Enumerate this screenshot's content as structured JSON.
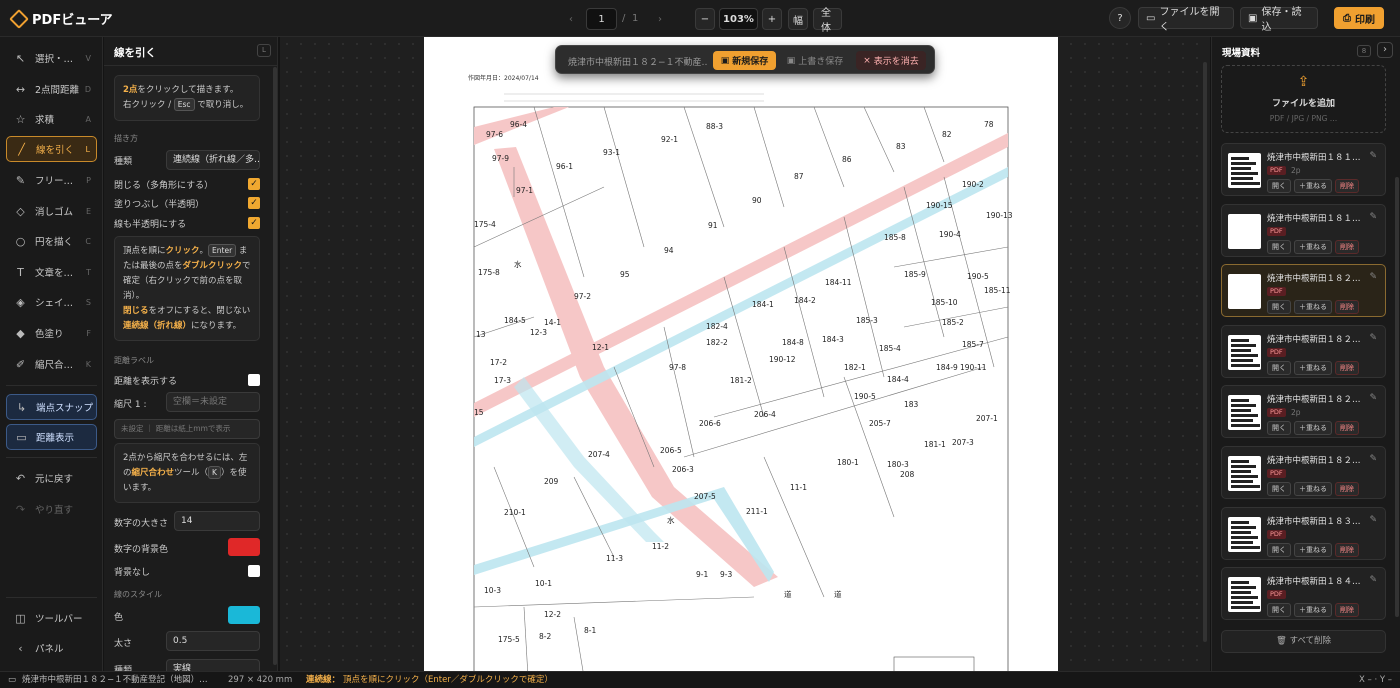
{
  "app": {
    "title": "PDFビューア"
  },
  "toolbar": {
    "prev_icon": "chevron-left-icon",
    "next_icon": "chevron-right-icon",
    "page_current": "1",
    "page_sep": "/",
    "page_total": "1",
    "zoom_out": "−",
    "zoom_value": "103%",
    "zoom_in": "+",
    "fit_width": "幅",
    "fit_all": "全体",
    "help_icon": "?",
    "open_file": "ファイルを開く",
    "save_load": "保存・読込",
    "print": "印刷"
  },
  "tools": [
    {
      "icon": "↖",
      "label": "選択・…",
      "key": "V"
    },
    {
      "icon": "↔",
      "label": "2点間距離",
      "key": "D"
    },
    {
      "icon": "☆",
      "label": "求積",
      "key": "A"
    },
    {
      "icon": "╱",
      "label": "線を引く",
      "key": "L"
    },
    {
      "icon": "✎",
      "label": "フリー…",
      "key": "P"
    },
    {
      "icon": "◇",
      "label": "消しゴム",
      "key": "E"
    },
    {
      "icon": "○",
      "label": "円を描く",
      "key": "C"
    },
    {
      "icon": "T",
      "label": "文章を…",
      "key": "T"
    },
    {
      "icon": "◈",
      "label": "シェイ…",
      "key": "S"
    },
    {
      "icon": "◆",
      "label": "色塗り",
      "key": "F"
    },
    {
      "icon": "✐",
      "label": "縮尺合…",
      "key": "K"
    }
  ],
  "toggles": [
    {
      "icon": "↳",
      "label": "端点スナップ"
    },
    {
      "icon": "▭",
      "label": "距離表示"
    }
  ],
  "history": {
    "undo": "元に戻す",
    "redo": "やり直す"
  },
  "rail_bottom": {
    "toolbar": "ツールバー",
    "panel": "パネル"
  },
  "panel": {
    "title": "線を引く",
    "title_key": "L",
    "hint1_a": "2点",
    "hint1_b": "をクリックして描きます。",
    "hint1_c": "右クリック / ",
    "hint1_kbd": "Esc",
    "hint1_d": " で取り消し。",
    "sect_draw": "描き方",
    "kind_label": "種類",
    "kind_value": "連続線（折れ線／多…",
    "close_label": "閉じる（多角形にする）",
    "fill_label": "塗りつぶし（半透明）",
    "semi_label": "線も半透明にする",
    "hint2_a": "頂点を順に",
    "hint2_b": "クリック",
    "hint2_c": "。",
    "hint2_kbd": "Enter",
    "hint2_d": " ま たは最後の点を",
    "hint2_e": "ダブルクリック",
    "hint2_f": "で確定（右クリックで前の点を取消）。",
    "hint2_g": "閉じる",
    "hint2_h": "をオフにすると、閉じない",
    "hint2_i": "連続線（折れ線）",
    "hint2_j": "になります。",
    "sect_dist": "距離ラベル",
    "show_dist": "距離を表示する",
    "scale_label": "縮尺 1 :",
    "scale_placeholder": "空欄＝未設定",
    "scale_note": "未設定 ｜ 距離は紙上mmで表示",
    "hint3_a": "2点から縮尺を合わせるには、左の",
    "hint3_b": "縮尺合わせ",
    "hint3_c": "ツール（",
    "hint3_kbd": "K",
    "hint3_d": "）を使います。",
    "num_size_label": "数字の大きさ",
    "num_size": "14",
    "num_bg_label": "数字の背景色",
    "no_bg_label": "背景なし",
    "sect_line": "線のスタイル",
    "color_label": "色",
    "width_label": "太さ",
    "width_value": "0.5",
    "type_label": "種類",
    "type_value": "実線"
  },
  "toast": {
    "file": "焼津市中根新田１８２−１不動産…",
    "new_save": "新規保存",
    "overwrite": "上書き保存",
    "hide": "表示を消去"
  },
  "map": {
    "date": "作図年月日：2024/07/14",
    "parcels": [
      "97-6",
      "96-4",
      "88-3",
      "92-1",
      "93-1",
      "96-1",
      "97-9",
      "97-1",
      "86",
      "83",
      "82",
      "78",
      "87",
      "90",
      "91",
      "94",
      "95",
      "97-2",
      "190-2",
      "190-15",
      "190-13",
      "190-4",
      "185-8",
      "185-9",
      "190-5",
      "185-11",
      "184-11",
      "184-1",
      "184-2",
      "185-10",
      "185-2",
      "182-4",
      "182-2",
      "184-8",
      "184-3",
      "185-3",
      "185-4",
      "185-7",
      "190-11",
      "190-12",
      "184-5",
      "12-3",
      "13",
      "17-2",
      "17-3",
      "12-1",
      "97-8",
      "181-2",
      "182-1",
      "184-4",
      "184-9",
      "206-4",
      "190-5",
      "183",
      "207-1",
      "206-6",
      "205-7",
      "181-1",
      "207-3",
      "206-5",
      "206-3",
      "180-1",
      "180-3",
      "208",
      "207-4",
      "207-5",
      "11-1",
      "211-1",
      "209",
      "210-1",
      "11-2",
      "11-3",
      "9-1",
      "9-3",
      "10-1",
      "10-3",
      "8-2",
      "8-1",
      "175-5",
      "175-8",
      "175-4",
      "15",
      "14-1",
      "12-2",
      "水",
      "水",
      "道",
      "道"
    ]
  },
  "right": {
    "title": "現場資料",
    "count": "8",
    "add_title": "ファイルを追加",
    "add_sub": "PDF / JPG / PNG …",
    "docs": [
      {
        "name": "焼津市中根新田１８１…",
        "badge": "PDF",
        "pages": "2p"
      },
      {
        "name": "焼津市中根新田１８１…",
        "badge": "PDF",
        "pages": ""
      },
      {
        "name": "焼津市中根新田１８２…",
        "badge": "PDF",
        "pages": ""
      },
      {
        "name": "焼津市中根新田１８２…",
        "badge": "PDF",
        "pages": ""
      },
      {
        "name": "焼津市中根新田１８２…",
        "badge": "PDF",
        "pages": "2p"
      },
      {
        "name": "焼津市中根新田１８２…",
        "badge": "PDF",
        "pages": ""
      },
      {
        "name": "焼津市中根新田１８３…",
        "badge": "PDF",
        "pages": ""
      },
      {
        "name": "焼津市中根新田１８４…",
        "badge": "PDF",
        "pages": ""
      }
    ],
    "open_btn": "開く",
    "overlay_btn": "＋重ねる",
    "delete_btn": "削除",
    "delete_all": "すべて削除"
  },
  "status": {
    "file": "焼津市中根新田１８２−１不動産登記（地図）…",
    "paper": "297 × 420 mm",
    "mode": "連続線：",
    "mode_hint": "頂点を順にクリック（Enter／ダブルクリックで確定）",
    "coords": "X – · Y –"
  },
  "colors": {
    "accent": "#f0a030",
    "num_bg": "#e02828",
    "line_color": "#1ab8d8",
    "road": "#f6c7c7",
    "water": "#bde6f0"
  }
}
